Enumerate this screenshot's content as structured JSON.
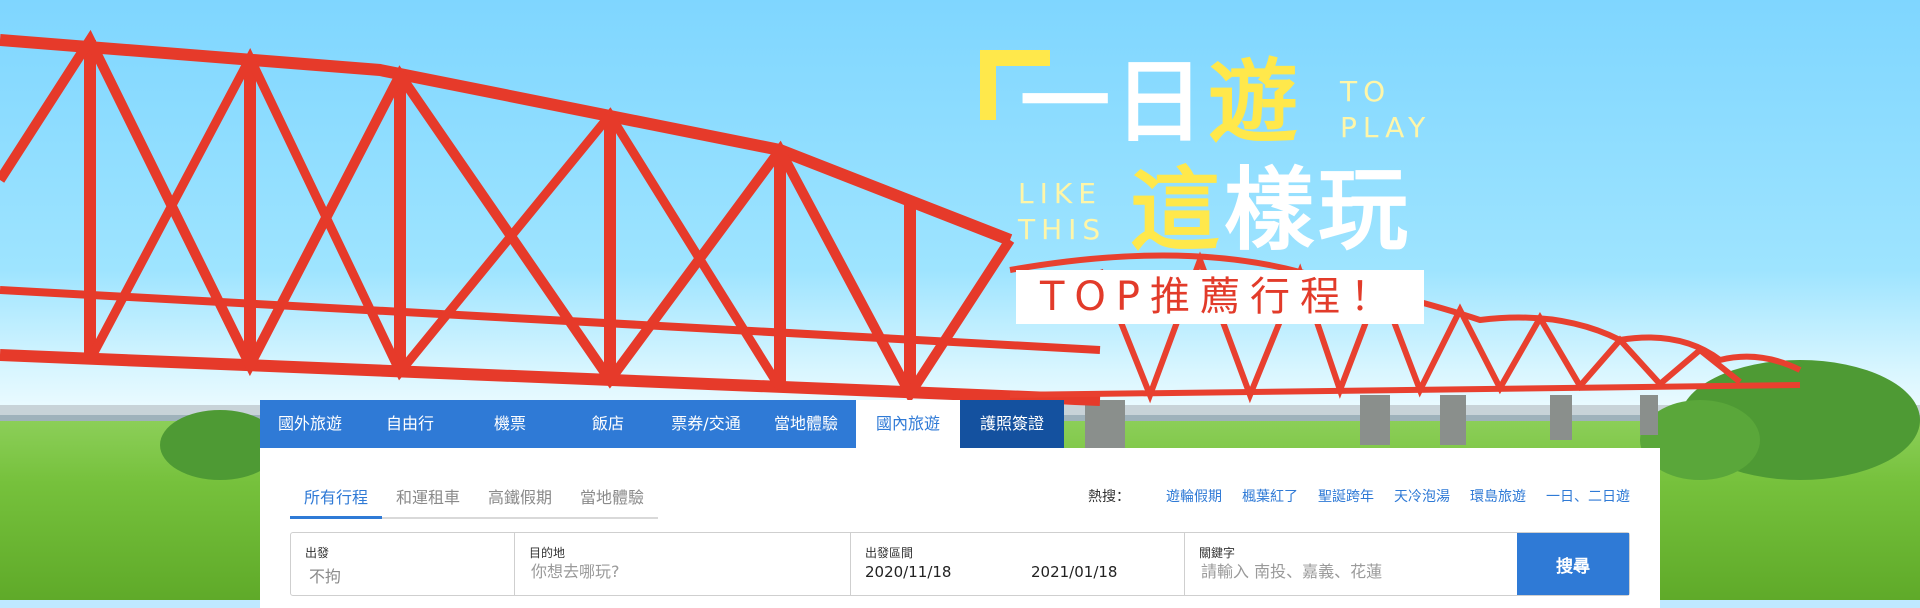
{
  "headline": {
    "line1_part1": "一",
    "line1_part2": "日",
    "line1_part3": "遊",
    "to": "TO",
    "play": "PLAY",
    "like": "LIKE",
    "this": "THIS",
    "line2_part1": "這",
    "line2_part2": "樣玩",
    "badge": "TOP推薦行程！"
  },
  "tabs": [
    {
      "label": "國外旅遊"
    },
    {
      "label": "自由行"
    },
    {
      "label": "機票"
    },
    {
      "label": "飯店"
    },
    {
      "label": "票券/交通"
    },
    {
      "label": "當地體驗"
    },
    {
      "label": "國內旅遊",
      "active": true
    },
    {
      "label": "護照簽證"
    }
  ],
  "subtabs": [
    {
      "label": "所有行程",
      "active": true
    },
    {
      "label": "和運租車"
    },
    {
      "label": "高鐵假期"
    },
    {
      "label": "當地體驗"
    }
  ],
  "hot": {
    "label": "熱搜：",
    "keywords": [
      "遊輪假期",
      "楓葉紅了",
      "聖誕跨年",
      "天冷泡湯",
      "環島旅遊",
      "一日、二日遊"
    ]
  },
  "search": {
    "departure_label": "出發",
    "departure_value": "不拘",
    "destination_label": "目的地",
    "destination_placeholder": "你想去哪玩?",
    "period_label": "出發區間",
    "date_start": "2020/11/18",
    "date_end": "2021/01/18",
    "keyword_label": "關鍵字",
    "keyword_placeholder": "請輸入 南投、嘉義、花蓮",
    "button": "搜尋"
  },
  "colors": {
    "primary": "#2f7ad6",
    "visa_tab": "#14519f",
    "highlight_yellow": "#ffe84b",
    "badge_red": "#e23b2a"
  }
}
